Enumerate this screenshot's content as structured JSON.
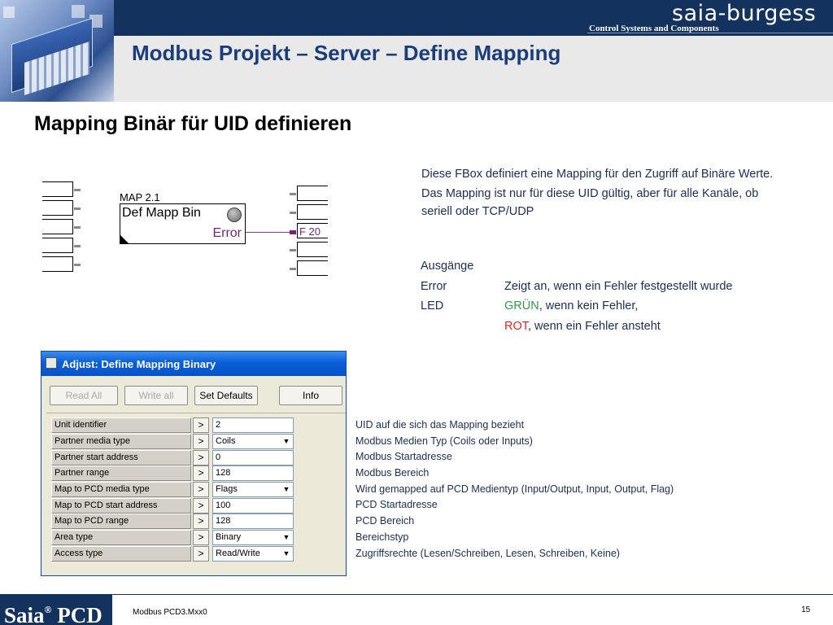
{
  "header": {
    "logo": "saia-burgess",
    "logo_tagline": "Control Systems and Components",
    "title": "Modbus Projekt – Server – Define Mapping"
  },
  "section_title": "Mapping Binär für UID definieren",
  "fbox": {
    "label": "MAP 2.1",
    "name": "Def Mapp Bin",
    "output": "Error",
    "flag": "F 20"
  },
  "description": [
    "Diese FBox definiert eine Mapping für den Zugriff auf Binäre Werte.",
    "Das Mapping ist nur für diese UID gültig, aber für alle Kanäle, ob seriell oder TCP/UDP"
  ],
  "outputs": {
    "heading": "Ausgänge",
    "error_key": "Error",
    "error_val": "Zeigt an, wenn ein Fehler festgestellt wurde",
    "led_key": "LED",
    "led_green": "GRÜN",
    "led_green_rest": ", wenn kein Fehler,",
    "led_red": "ROT",
    "led_red_rest": ", wenn ein Fehler ansteht",
    "colors": {
      "green": "#2e9a4a",
      "red": "#e0261c"
    }
  },
  "dialog": {
    "title": "Adjust: Define Mapping Binary",
    "buttons": {
      "read_all": "Read All",
      "write_all": "Write all",
      "set_defaults": "Set Defaults",
      "info": "Info"
    },
    "rows": [
      {
        "label": "Unit identifier",
        "value": "2"
      },
      {
        "label": "Partner media type",
        "value": "Coils"
      },
      {
        "label": "Partner start address",
        "value": "0"
      },
      {
        "label": "Partner range",
        "value": "128"
      },
      {
        "label": "Map to PCD media type",
        "value": "Flags"
      },
      {
        "label": "Map to PCD start address",
        "value": "100"
      },
      {
        "label": "Map to PCD range",
        "value": "128"
      },
      {
        "label": "Area type",
        "value": "Binary"
      },
      {
        "label": "Access type",
        "value": "Read/Write"
      }
    ]
  },
  "field_notes": [
    "UID auf die sich das Mapping bezieht",
    "Modbus Medien Typ (Coils oder Inputs)",
    "Modbus Startadresse",
    "Modbus Bereich",
    "Wird gemapped auf PCD Medientyp (Input/Output, Input, Output, Flag)",
    "PCD Startadresse",
    "PCD Bereich",
    "Bereichstyp",
    "Zugriffsrechte (Lesen/Schreiben, Lesen, Schreiben, Keine)"
  ],
  "footer": {
    "brand": "Saia",
    "brand_suffix": "PCD",
    "doc": "Modbus PCD3.Mxx0",
    "page": "15"
  }
}
